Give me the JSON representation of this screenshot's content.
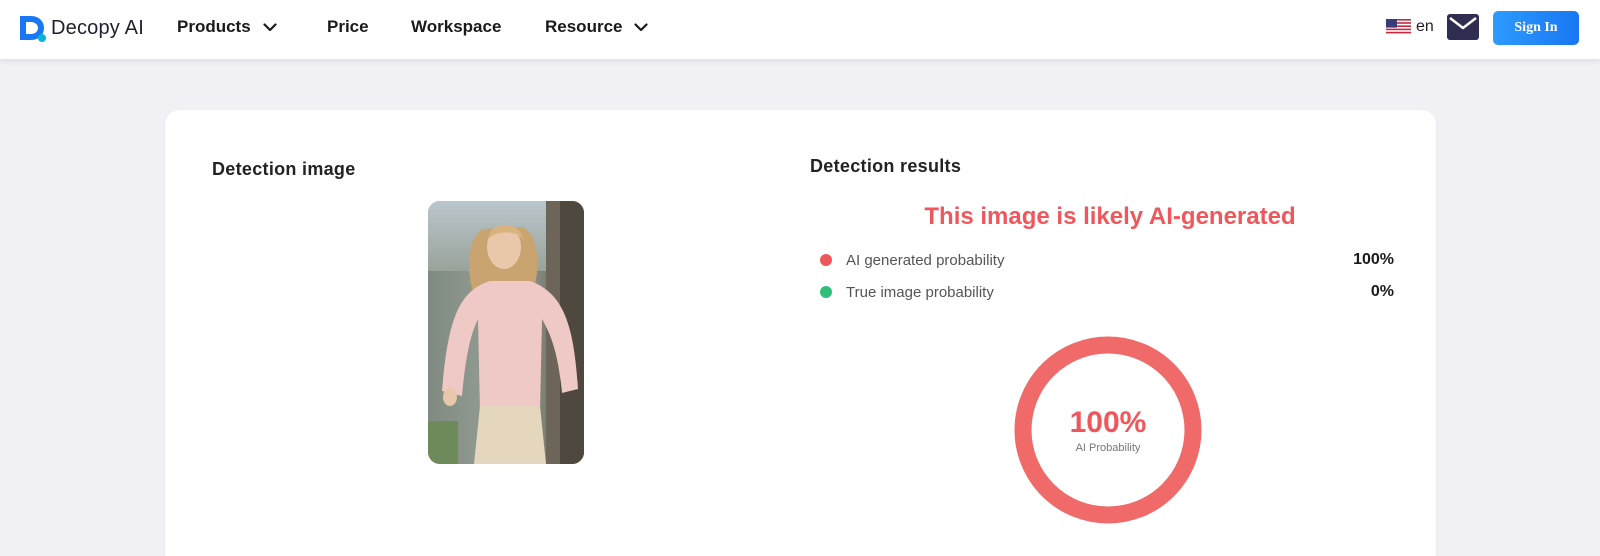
{
  "nav": {
    "brand": "Decopy AI",
    "items": [
      {
        "label": "Products",
        "dropdown": true
      },
      {
        "label": "Price",
        "dropdown": false
      },
      {
        "label": "Workspace",
        "dropdown": false
      },
      {
        "label": "Resource",
        "dropdown": true
      }
    ],
    "language": "en",
    "sign_in": "Sign In"
  },
  "detection": {
    "image_title": "Detection image",
    "results_title": "Detection results",
    "verdict": "This image is likely AI-generated",
    "rows": [
      {
        "label": "AI generated probability",
        "value": "100%",
        "color": "#f0575c"
      },
      {
        "label": "True image probability",
        "value": "0%",
        "color": "#2ec07a"
      }
    ],
    "ring": {
      "value": "100%",
      "caption": "AI Probability",
      "fraction": 1.0,
      "color": "#f0575c"
    }
  },
  "colors": {
    "accent": "#1877f2",
    "ai": "#f0575c",
    "real": "#2ec07a"
  },
  "icons": [
    "logo-icon",
    "chevron-down-icon",
    "us-flag-icon",
    "mail-icon"
  ]
}
